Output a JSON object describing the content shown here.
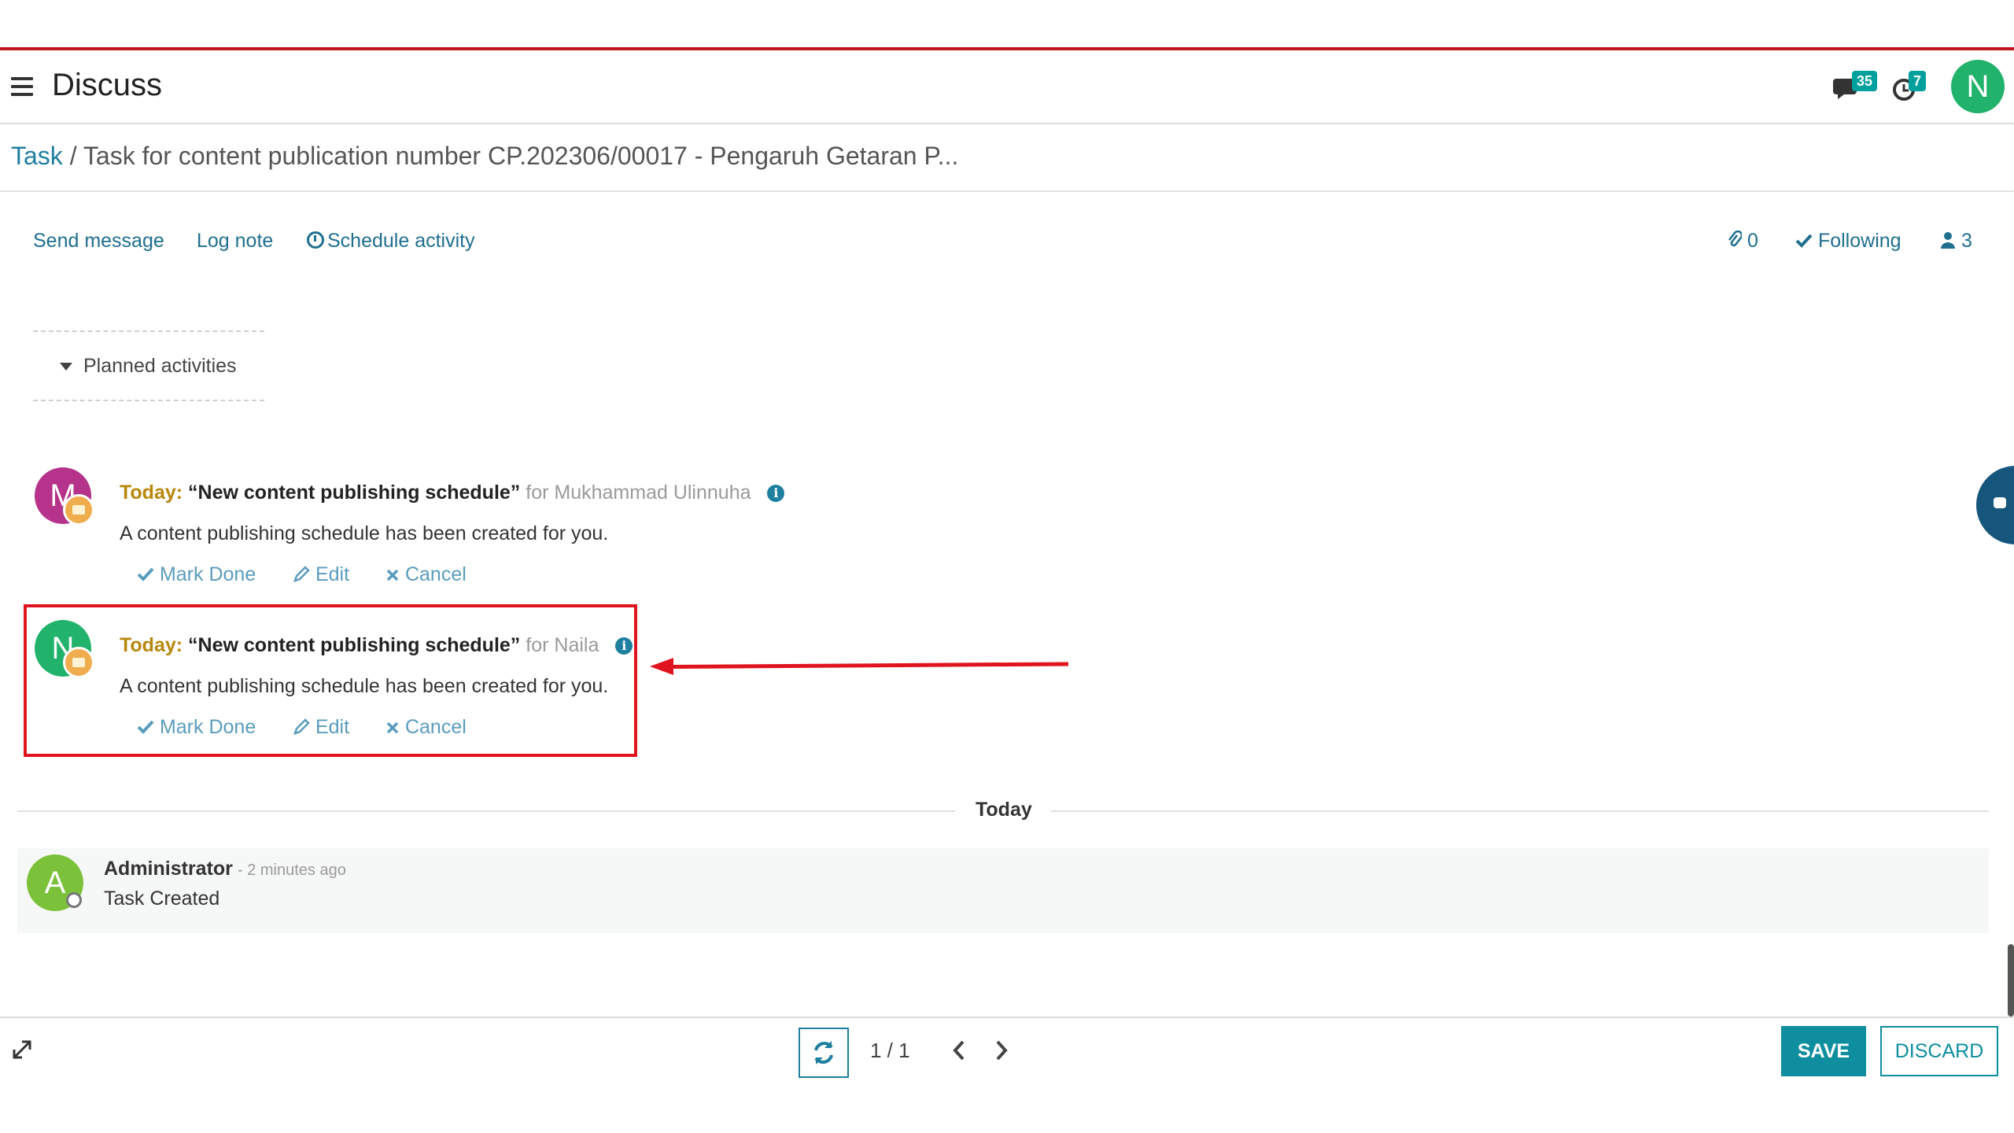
{
  "app": {
    "title": "Discuss"
  },
  "navbar": {
    "messages_badge": "35",
    "activities_badge": "7",
    "user_initial": "N"
  },
  "breadcrumb": {
    "parent": "Task",
    "separator": " / ",
    "current": "Task for content publication number CP.202306/00017 - Pengaruh Getaran P..."
  },
  "chatter": {
    "send_message": "Send message",
    "log_note": "Log note",
    "schedule_activity": "Schedule activity",
    "attachments_count": "0",
    "following": "Following",
    "followers_count": "3"
  },
  "planned": {
    "label": "Planned activities"
  },
  "activities": [
    {
      "avatar_initial": "M",
      "avatar_color": "#b5338a",
      "due": "Today:",
      "title": "“New content publishing schedule”",
      "for_text": "for Mukhammad Ulinnuha",
      "info": "i",
      "description": "A content publishing schedule has been created for you.",
      "mark_done": "Mark Done",
      "edit": "Edit",
      "cancel": "Cancel"
    },
    {
      "avatar_initial": "N",
      "avatar_color": "#21b26b",
      "due": "Today:",
      "title": "“New content publishing schedule”",
      "for_text": "for Naila",
      "info": "i",
      "description": "A content publishing schedule has been created for you.",
      "mark_done": "Mark Done",
      "edit": "Edit",
      "cancel": "Cancel"
    }
  ],
  "separator": {
    "label": "Today"
  },
  "message": {
    "avatar_initial": "A",
    "avatar_color": "#7cc13a",
    "author": "Administrator",
    "time": "- 2 minutes ago",
    "body": "Task Created"
  },
  "pager": {
    "value": "1 / 1"
  },
  "footer": {
    "save": "SAVE",
    "discard": "DISCARD"
  },
  "colors": {
    "accent": "#0e8e9e",
    "link": "#1f7f9f",
    "highlight": "#e0141e",
    "today": "#b8860b"
  },
  "icons": [
    "hamburger-icon",
    "messages-icon",
    "activities-clock-icon",
    "paperclip-icon",
    "check-icon",
    "person-icon",
    "caret-down-icon",
    "info-icon",
    "pencil-icon",
    "x-icon",
    "refresh-icon",
    "chevron-left-icon",
    "chevron-right-icon",
    "expand-icon",
    "chat-bubble-icon"
  ]
}
